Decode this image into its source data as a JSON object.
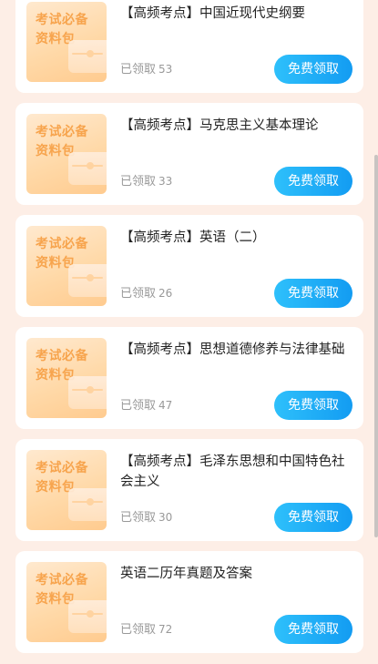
{
  "thumb_text": "考试必备\n资料包",
  "items": [
    {
      "title": "【高频考点】中国近现代史纲要",
      "claimed_label": "已领取",
      "count": "53",
      "button": "免费领取"
    },
    {
      "title": "【高频考点】马克思主义基本理论",
      "claimed_label": "已领取",
      "count": "33",
      "button": "免费领取"
    },
    {
      "title": "【高频考点】英语（二）",
      "claimed_label": "已领取",
      "count": "26",
      "button": "免费领取"
    },
    {
      "title": "【高频考点】思想道德修养与法律基础",
      "claimed_label": "已领取",
      "count": "47",
      "button": "免费领取"
    },
    {
      "title": "【高频考点】毛泽东思想和中国特色社会主义",
      "claimed_label": "已领取",
      "count": "30",
      "button": "免费领取"
    },
    {
      "title": "英语二历年真题及答案",
      "claimed_label": "已领取",
      "count": "72",
      "button": "免费领取"
    }
  ]
}
